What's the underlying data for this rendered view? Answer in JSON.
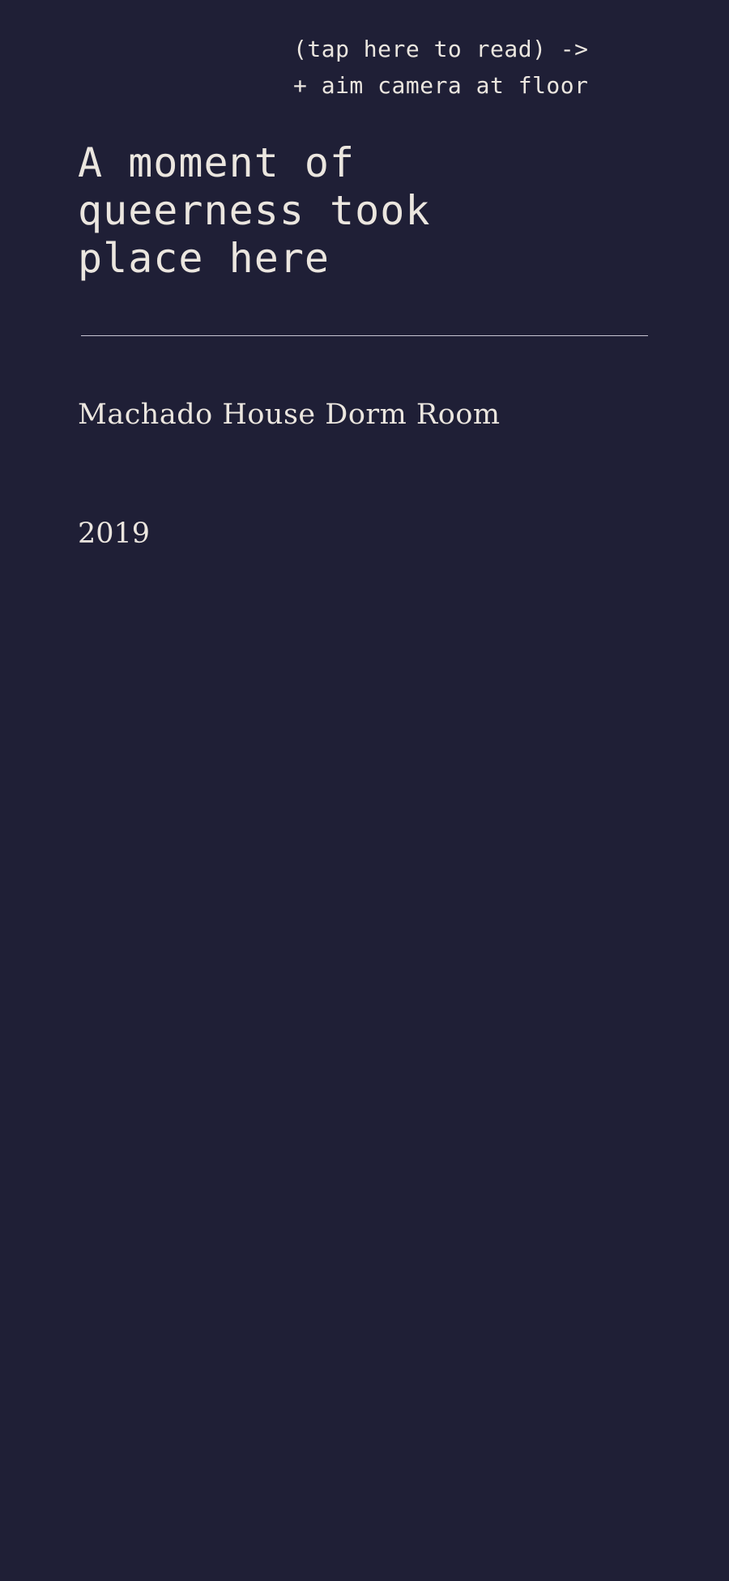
{
  "hint": {
    "line1": "(tap here to read) ->",
    "line2": "+ aim camera at floor"
  },
  "title": {
    "line1": "A moment of",
    "line2": "queerness took",
    "line3": "place here"
  },
  "location": "Machado House Dorm Room",
  "year": "2019",
  "colors": {
    "background": "#1f1f36",
    "text": "#ebe6df",
    "divider": "#c9c6d4"
  }
}
